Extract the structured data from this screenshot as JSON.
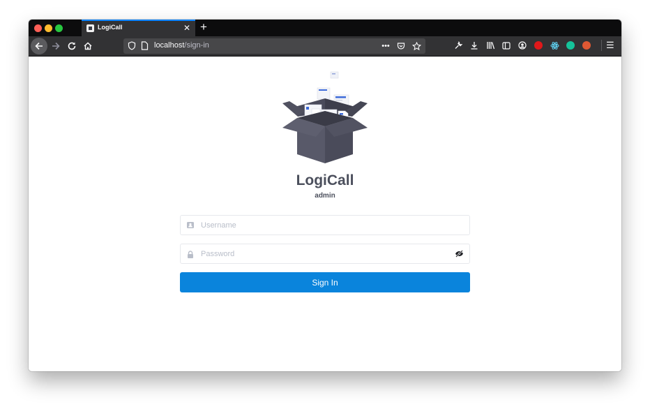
{
  "browser": {
    "tab": {
      "title": "LogiCall",
      "close_glyph": "✕"
    },
    "new_tab_glyph": "+",
    "url": {
      "host": "localhost",
      "path": "/sign-in"
    },
    "icons": {
      "nav": [
        "back-arrow-icon",
        "forward-arrow-icon",
        "reload-icon",
        "home-icon"
      ],
      "url_bar": [
        "shield-icon",
        "page-icon",
        "more-actions-icon",
        "pocket-icon",
        "bookmark-star-icon"
      ],
      "toolbar": [
        "wrench-icon",
        "download-icon",
        "library-icon",
        "sidebar-icon",
        "account-icon",
        "react-devtools-icon",
        "grammarly-icon",
        "duckduckgo-icon",
        "hamburger-menu-icon"
      ]
    },
    "colors": {
      "tabbar_bg": "#0c0c0d",
      "toolbar_bg": "#323234",
      "tab_accent": "#0a84ff"
    }
  },
  "login": {
    "app_name": "LogiCall",
    "subtitle": "admin",
    "username_placeholder": "Username",
    "password_placeholder": "Password",
    "submit_label": "Sign In",
    "colors": {
      "primary": "#0a84dc",
      "title": "#4b4f5c",
      "input_border": "#e6e8ec"
    }
  }
}
